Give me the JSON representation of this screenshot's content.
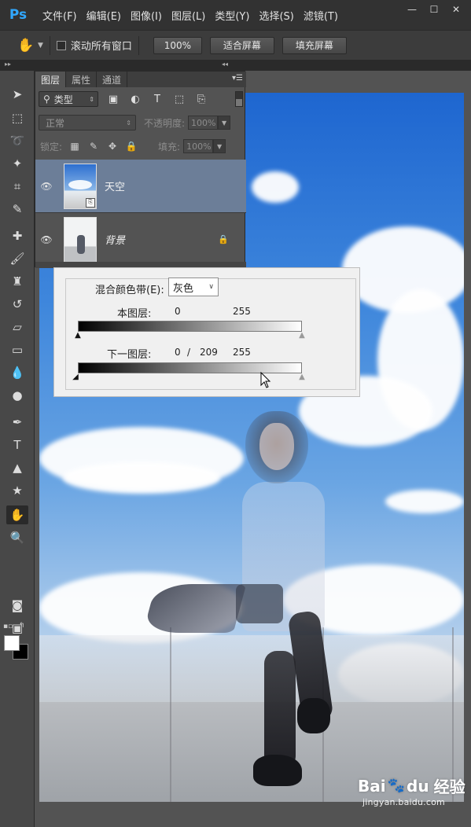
{
  "app": {
    "logo": "Ps"
  },
  "menu": [
    "文件(F)",
    "编辑(E)",
    "图像(I)",
    "图层(L)",
    "类型(Y)",
    "选择(S)",
    "滤镜(T)"
  ],
  "window_controls": {
    "minimize": "—",
    "restore": "☐",
    "close": "✕"
  },
  "options_bar": {
    "tool_icon": "hand-icon",
    "scroll_all_label": "滚动所有窗口",
    "zoom_100": "100%",
    "fit_screen": "适合屏幕",
    "fill_screen": "填充屏幕"
  },
  "layers_panel": {
    "tabs": [
      "图层",
      "属性",
      "通道"
    ],
    "filter": {
      "label": "类型"
    },
    "blend_mode": "正常",
    "opacity_label": "不透明度:",
    "opacity_value": "100%",
    "lock_label": "锁定:",
    "fill_label": "填充:",
    "fill_value": "100%",
    "layers": [
      {
        "name": "天空",
        "selected": true,
        "visible": true
      },
      {
        "name": "背景",
        "selected": false,
        "visible": true,
        "locked": true
      }
    ]
  },
  "blend_if": {
    "label": "混合颜色带(E):",
    "channel": "灰色",
    "this_layer_label": "本图层:",
    "this_layer_black": "0",
    "this_layer_white": "255",
    "underlying_label": "下一图层:",
    "underlying_black": "0",
    "underlying_split_sep": "/",
    "underlying_split": "209",
    "underlying_white": "255"
  },
  "watermark": {
    "brand_text": "Bai",
    "brand_text2": "du",
    "jingyan": "经验",
    "url": "jingyan.baidu.com"
  },
  "colors": {
    "accent": "#31a8ff",
    "selected_layer": "#6c7e98",
    "foreground": "#ffffff",
    "background": "#000000"
  }
}
